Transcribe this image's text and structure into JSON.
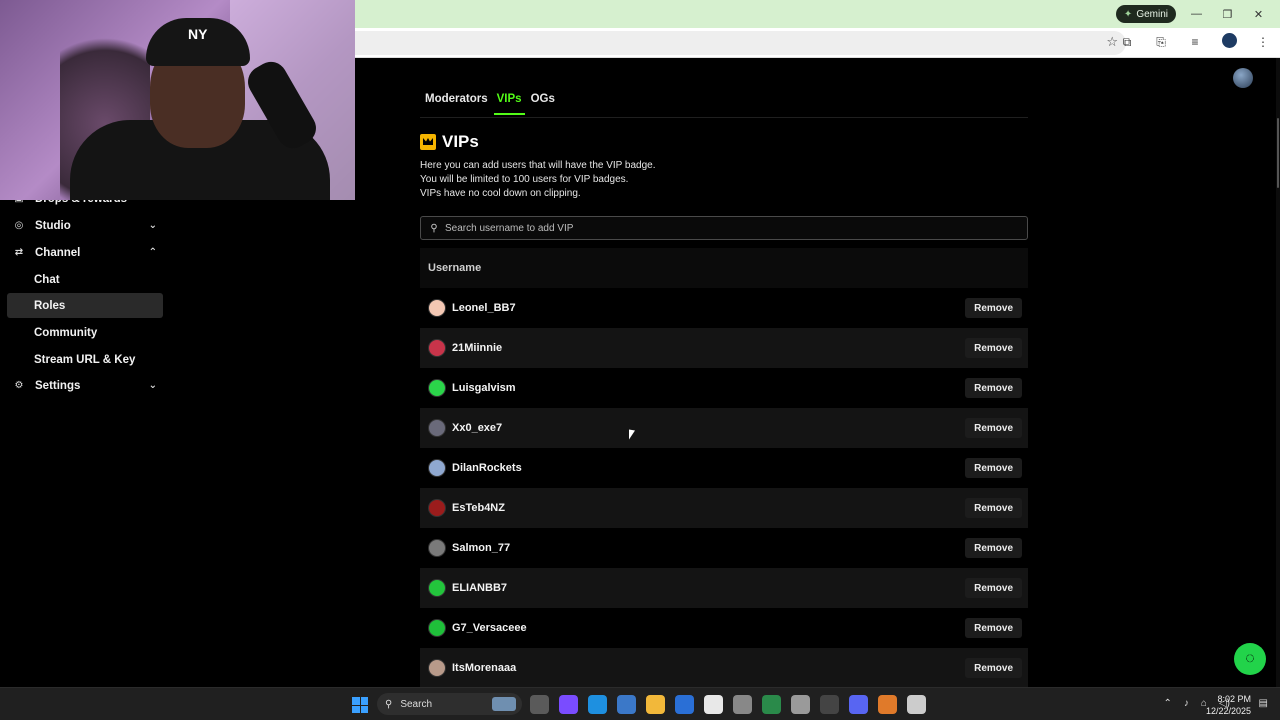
{
  "browser": {
    "gemini_label": "Gemini",
    "window_controls": [
      "—",
      "❐",
      "✕"
    ]
  },
  "webcam": {
    "cap_logo": "NY"
  },
  "sidebar": {
    "partial_item": "Drops & rewards",
    "items": [
      {
        "label": "Studio",
        "icon": "studio-icon",
        "chevron": "⌄"
      },
      {
        "label": "Channel",
        "icon": "channel-icon",
        "chevron": "⌃"
      },
      {
        "label": "Chat"
      },
      {
        "label": "Roles",
        "active": true
      },
      {
        "label": "Community"
      },
      {
        "label": "Stream URL & Key"
      },
      {
        "label": "Settings",
        "icon": "gear-icon",
        "chevron": "⌄"
      }
    ]
  },
  "tabs": [
    {
      "label": "Moderators"
    },
    {
      "label": "VIPs",
      "active": true
    },
    {
      "label": "OGs"
    }
  ],
  "section": {
    "title": "VIPs",
    "desc": [
      "Here you can add users that will have the VIP badge.",
      "You will be limited to 100 users for VIP badges.",
      "VIPs have no cool down on clipping."
    ],
    "search_placeholder": "Search username to add VIP"
  },
  "table": {
    "header": "Username",
    "remove_label": "Remove",
    "rows": [
      {
        "name": "Leonel_BB7",
        "avatar_color": "#f3c7b3"
      },
      {
        "name": "21Miinnie",
        "avatar_color": "#c8344a"
      },
      {
        "name": "Luisgalvism",
        "avatar_color": "#2bd44a"
      },
      {
        "name": "Xx0_exe7",
        "avatar_color": "#6a6a7a"
      },
      {
        "name": "DilanRockets",
        "avatar_color": "#8fa8d0"
      },
      {
        "name": "EsTeb4NZ",
        "avatar_color": "#9b1c1c"
      },
      {
        "name": "Salmon_77",
        "avatar_color": "#7a7a7a"
      },
      {
        "name": "ELIANBB7",
        "avatar_color": "#23c43c"
      },
      {
        "name": "G7_Versaceee",
        "avatar_color": "#1fbf3a"
      },
      {
        "name": "ItsMorenaaa",
        "avatar_color": "#b89a8a"
      }
    ]
  },
  "taskbar": {
    "search_label": "Search",
    "time": "8:02 PM",
    "date": "12/22/2025",
    "app_colors": [
      "#5a5a5a",
      "#7a4cff",
      "#1e90e0",
      "#3b78c8",
      "#f2b83a",
      "#2a6fd6",
      "#e8e8e8",
      "#888",
      "#2a8a4a",
      "#9a9a9a",
      "#444",
      "#5865f2",
      "#e07a2a",
      "#ccc"
    ]
  }
}
